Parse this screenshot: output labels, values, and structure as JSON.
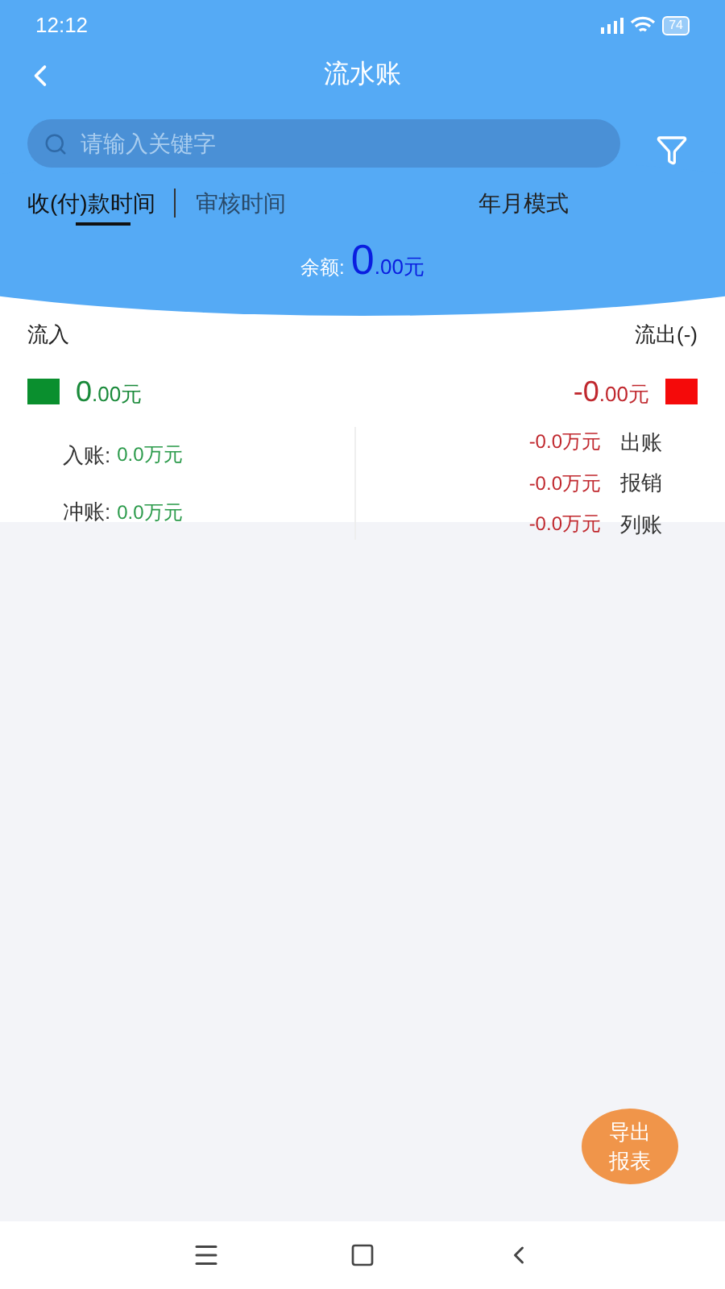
{
  "status_bar": {
    "time": "12:12",
    "battery": "74"
  },
  "header": {
    "title": "流水账"
  },
  "search": {
    "placeholder": "请输入关键字"
  },
  "tabs": [
    {
      "label": "收(付)款时间",
      "selected": true
    },
    {
      "label": "审核时间",
      "selected": false
    }
  ],
  "mode_button": "年月模式",
  "balance": {
    "label": "余额:",
    "integer": "0",
    "fraction": ".00元"
  },
  "inflow": {
    "title": "流入",
    "integer": "0",
    "fraction": ".00元",
    "color": "#0a8f2e",
    "rows": [
      {
        "label": "入账:",
        "value": "0.0万元"
      },
      {
        "label": "冲账:",
        "value": "0.0万元"
      }
    ]
  },
  "outflow": {
    "title": "流出(-)",
    "integer": "-0",
    "fraction": ".00元",
    "color": "#f50a0a",
    "rows": [
      {
        "value": "-0.0万元",
        "label": "出账"
      },
      {
        "value": "-0.0万元",
        "label": "报销"
      },
      {
        "value": "-0.0万元",
        "label": "列账"
      }
    ]
  },
  "export_button": [
    "导出",
    "报表"
  ]
}
